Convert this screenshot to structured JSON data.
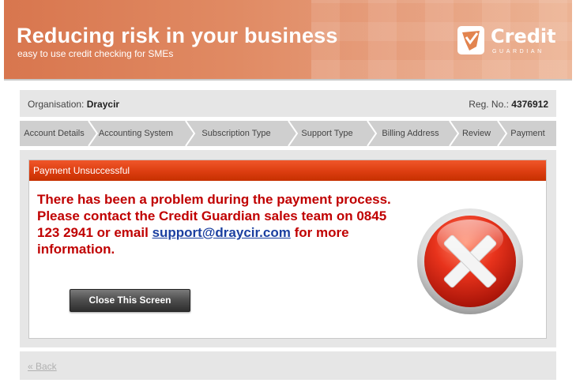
{
  "banner": {
    "title": "Reducing risk in your business",
    "subtitle": "easy to use credit checking for SMEs",
    "logo_word": "Credit",
    "logo_sub": "GUARDIAN"
  },
  "org": {
    "org_label": "Organisation:",
    "org_value": "Draycir",
    "reg_label": "Reg. No.:",
    "reg_value": "4376912"
  },
  "steps": [
    {
      "label": "Account Details"
    },
    {
      "label": "Accounting System"
    },
    {
      "label": "Subscription Type"
    },
    {
      "label": "Support Type"
    },
    {
      "label": "Billing Address"
    },
    {
      "label": "Review"
    },
    {
      "label": "Payment"
    }
  ],
  "dialog": {
    "header": "Payment Unsuccessful",
    "message_before": "There has been a problem during the payment process. Please contact the Credit Guardian sales team on 0845 123 2941 or email",
    "email": "support@draycir.com",
    "message_after": "for more information.",
    "close_label": "Close This Screen"
  },
  "footer": {
    "back_label": "« Back"
  },
  "colors": {
    "banner": "#e08a63",
    "header_red": "#dc3d10",
    "message_red": "#c00000",
    "link_blue": "#1b3fa0"
  },
  "icons": {
    "error": "error-x-icon",
    "logo": "shield-check-icon",
    "step_separator": "chevron-right-icon"
  }
}
